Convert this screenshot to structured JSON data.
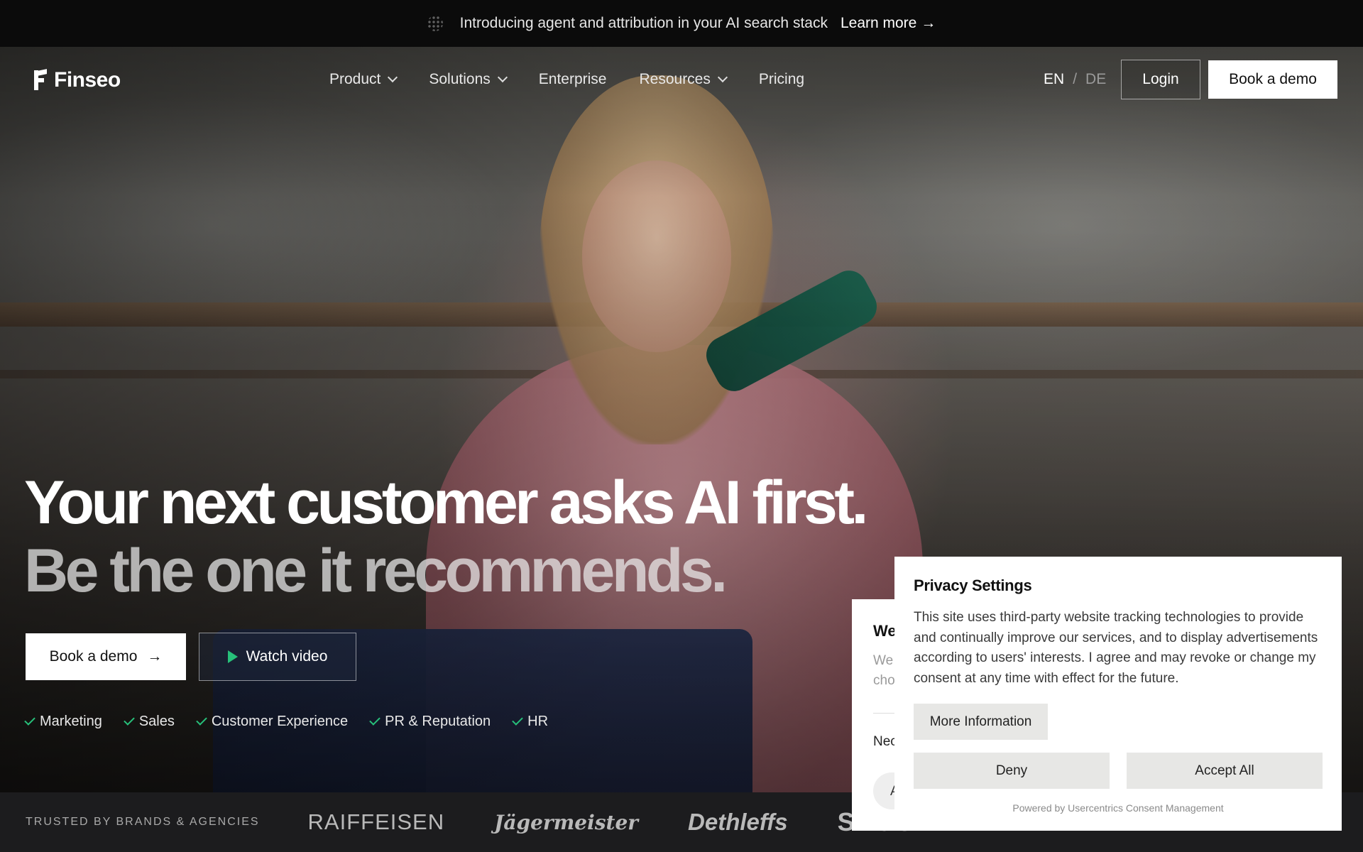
{
  "announcement": {
    "message": "Introducing agent and attribution in your AI search stack",
    "link_label": "Learn more",
    "link_arrow": "→"
  },
  "nav": {
    "logo_text": "Finseo",
    "items": [
      {
        "label": "Product",
        "dropdown": true
      },
      {
        "label": "Solutions",
        "dropdown": true
      },
      {
        "label": "Enterprise",
        "dropdown": false
      },
      {
        "label": "Resources",
        "dropdown": true
      },
      {
        "label": "Pricing",
        "dropdown": false
      }
    ],
    "lang_active": "EN",
    "lang_sep": "/",
    "lang_other": "DE",
    "login_label": "Login",
    "demo_label": "Book a demo"
  },
  "hero": {
    "headline": "Your next customer asks AI first.",
    "subheadline": "Be the one it recommends.",
    "cta_primary": "Book a demo",
    "cta_primary_arrow": "→",
    "cta_secondary": "Watch video",
    "tags": [
      "Marketing",
      "Sales",
      "Customer Experience",
      "PR & Reputation",
      "HR"
    ]
  },
  "trusted": {
    "label": "TRUSTED BY BRANDS & AGENCIES",
    "brands": [
      "RAIFFEISEN",
      "Jägermeister",
      "Dethleffs",
      "SNOC"
    ]
  },
  "background_modal": {
    "title_fragment": "We",
    "line1_fragment": "We",
    "line2_fragment": "cho",
    "section_fragment": "Nec",
    "button_fragment": "A"
  },
  "privacy": {
    "title": "Privacy Settings",
    "body": "This site uses third-party website tracking technologies to provide and continually improve our services, and to display advertisements according to users' interests. I agree and may revoke or change my consent at any time with effect for the future.",
    "more_label": "More Information",
    "deny_label": "Deny",
    "accept_label": "Accept All",
    "powered_by": "Powered by Usercentrics Consent Management"
  },
  "colors": {
    "accent_green": "#27c07a",
    "announcement_bg": "#0b0b0b",
    "trusted_bg": "#1c1c1e",
    "modal_button_bg": "#e7e7e5"
  }
}
